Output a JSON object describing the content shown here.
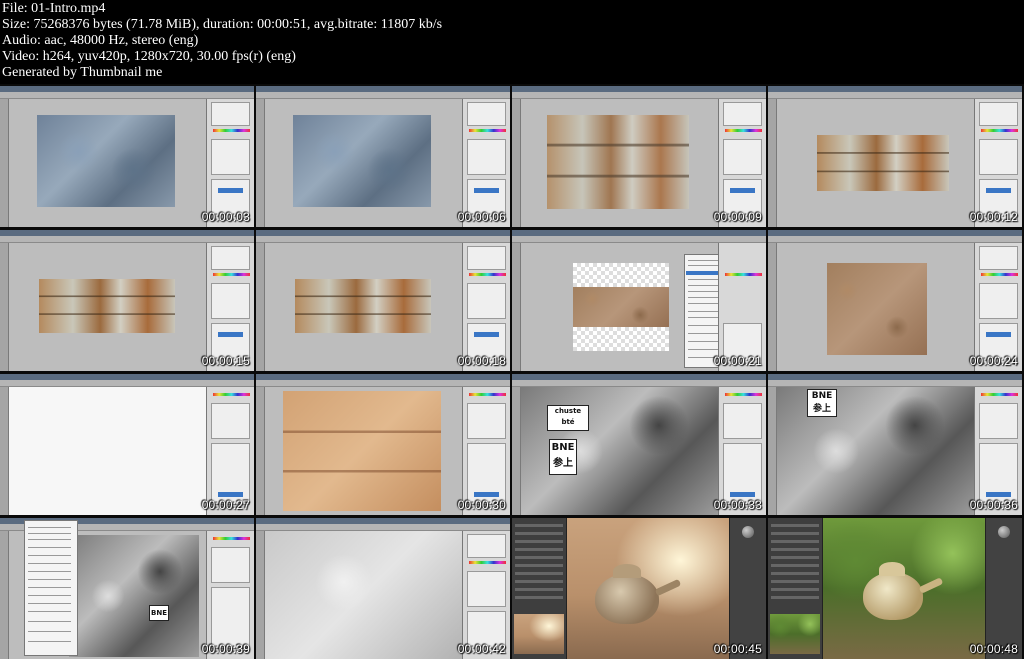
{
  "header": {
    "file": "File: 01-Intro.mp4",
    "size": "Size: 75268376 bytes (71.78 MiB), duration: 00:00:51, avg.bitrate: 11807 kb/s",
    "audio": "Audio: aac, 48000 Hz, stereo (eng)",
    "video": "Video: h264, yuv420p, 1280x720, 30.00 fps(r) (eng)",
    "generator": "Generated by Thumbnail me"
  },
  "thumbnails": [
    {
      "time": "00:00:03",
      "scene": "photoshop-metal-texture"
    },
    {
      "time": "00:00:06",
      "scene": "photoshop-metal-texture"
    },
    {
      "time": "00:00:09",
      "scene": "photoshop-rust-metal-blend"
    },
    {
      "time": "00:00:12",
      "scene": "photoshop-rust-metal"
    },
    {
      "time": "00:00:15",
      "scene": "photoshop-rust-strip"
    },
    {
      "time": "00:00:18",
      "scene": "photoshop-rust-strip"
    },
    {
      "time": "00:00:21",
      "scene": "photoshop-sand-context-menu"
    },
    {
      "time": "00:00:24",
      "scene": "photoshop-sand-texture"
    },
    {
      "time": "00:00:27",
      "scene": "photoshop-sketch-outline"
    },
    {
      "time": "00:00:30",
      "scene": "photoshop-hieroglyph-relief"
    },
    {
      "time": "00:00:33",
      "scene": "photoshop-graffiti-wall"
    },
    {
      "time": "00:00:36",
      "scene": "photoshop-graffiti-closeup"
    },
    {
      "time": "00:00:39",
      "scene": "photoshop-graffiti-menu"
    },
    {
      "time": "00:00:42",
      "scene": "photoshop-graffiti-light"
    },
    {
      "time": "00:00:45",
      "scene": "render-teapot-room"
    },
    {
      "time": "00:00:48",
      "scene": "render-teapot-forest"
    }
  ],
  "signs": {
    "bne": "BNE",
    "kanji": "参上",
    "tag": "chuste bté"
  }
}
